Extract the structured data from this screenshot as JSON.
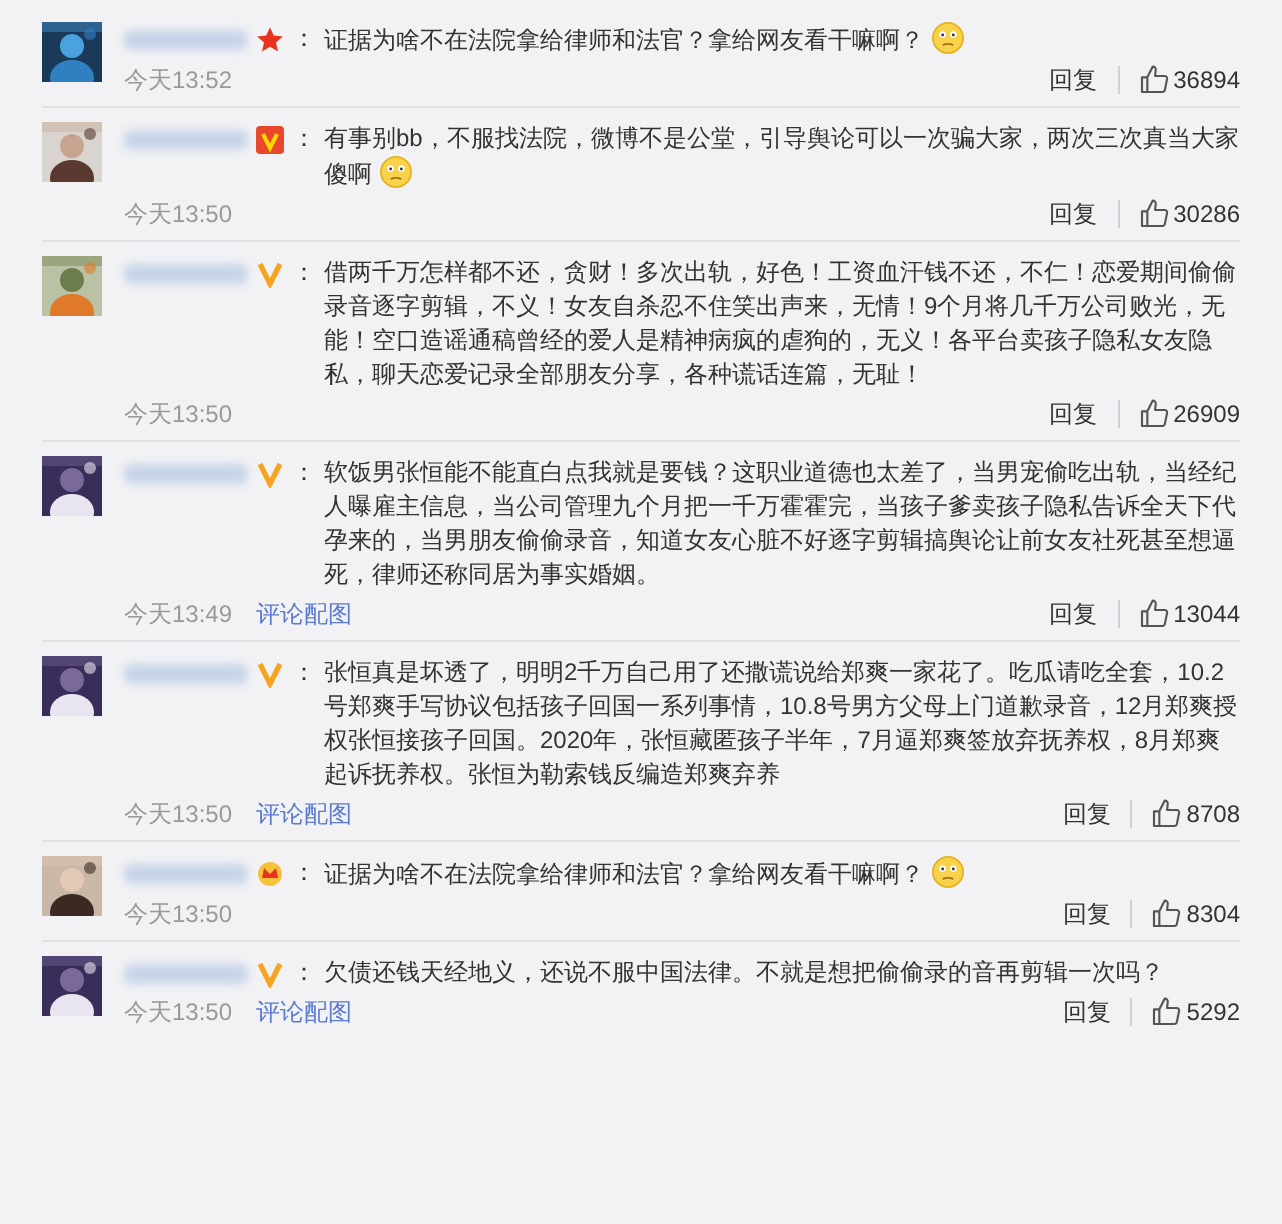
{
  "comments": [
    {
      "kind": "star",
      "colon": "：",
      "text": "证据为啥不在法院拿给律师和法官？拿给网友看干嘛啊？",
      "emoji": true,
      "time": "今天13:52",
      "reply": "回复",
      "likes": "36894"
    },
    {
      "kind": "v-box",
      "colon": "：",
      "text": "有事别bb，不服找法院，微博不是公堂，引导舆论可以一次骗大家，两次三次真当大家傻啊",
      "emoji": true,
      "time": "今天13:50",
      "reply": "回复",
      "likes": "30286"
    },
    {
      "kind": "v",
      "colon": "：",
      "text": "借两千万怎样都不还，贪财！多次出轨，好色！工资血汗钱不还，不仁！恋爱期间偷偷录音逐字剪辑，不义！女友自杀忍不住笑出声来，无情！9个月将几千万公司败光，无能！空口造谣通稿曾经的爱人是精神病疯的虐狗的，无义！各平台卖孩子隐私女友隐私，聊天恋爱记录全部朋友分享，各种谎话连篇，无耻！",
      "emoji": false,
      "time": "今天13:50",
      "reply": "回复",
      "likes": "26909"
    },
    {
      "kind": "v",
      "colon": "：",
      "text": "软饭男张恒能不能直白点我就是要钱？这职业道德也太差了，当男宠偷吃出轨，当经纪人曝雇主信息，当公司管理九个月把一千万霍霍完，当孩子爹卖孩子隐私告诉全天下代孕来的，当男朋友偷偷录音，知道女友心脏不好逐字剪辑搞舆论让前女友社死甚至想逼死，律师还称同居为事实婚姻。",
      "link": "评论配图",
      "emoji": false,
      "time": "今天13:49",
      "reply": "回复",
      "likes": "13044"
    },
    {
      "kind": "v",
      "colon": "：",
      "text": "张恒真是坏透了，明明2千万自己用了还撒谎说给郑爽一家花了。吃瓜请吃全套，10.2号郑爽手写协议包括孩子回国一系列事情，10.8号男方父母上门道歉录音，12月郑爽授权张恒接孩子回国。2020年，张恒藏匿孩子半年，7月逼郑爽签放弃抚养权，8月郑爽起诉抚养权。张恒为勒索钱反编造郑爽弃养",
      "link": "评论配图",
      "emoji": false,
      "time": "今天13:50",
      "reply": "回复",
      "likes": "8708"
    },
    {
      "kind": "crown",
      "colon": "：",
      "text": "证据为啥不在法院拿给律师和法官？拿给网友看干嘛啊？",
      "emoji": true,
      "time": "今天13:50",
      "reply": "回复",
      "likes": "8304"
    },
    {
      "kind": "v",
      "colon": "：",
      "text": "欠债还钱天经地义，还说不服中国法律。不就是想把偷偷录的音再剪辑一次吗？",
      "link": "评论配图",
      "emoji": false,
      "time": "今天13:50",
      "reply": "回复",
      "likes": "5292"
    }
  ]
}
